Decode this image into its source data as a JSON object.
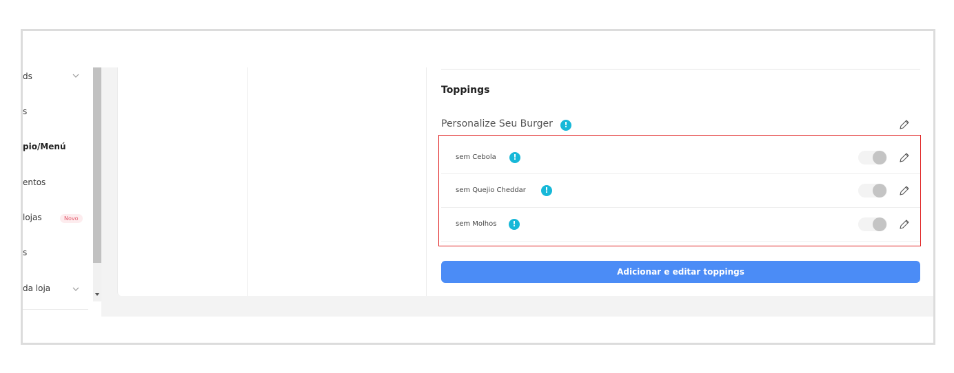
{
  "sidebar": {
    "items": [
      {
        "label": "ds",
        "chevron": true
      },
      {
        "label": "s"
      },
      {
        "label": "pio/Menú",
        "active": true
      },
      {
        "label": "entos"
      },
      {
        "label": "lojas",
        "badge": "Novo"
      },
      {
        "label": "s"
      },
      {
        "label": "da loja",
        "chevron": true
      }
    ]
  },
  "toppings": {
    "section_title": "Toppings",
    "group_title": "Personalize Seu Burger",
    "info_glyph": "!",
    "items": [
      {
        "label": "sem Cebola",
        "enabled": false
      },
      {
        "label": "sem Quejio Cheddar",
        "enabled": false
      },
      {
        "label": "sem Molhos",
        "enabled": false
      }
    ],
    "add_button_label": "Adicionar e editar toppings"
  },
  "colors": {
    "accent": "#4b8cf6",
    "info": "#17b8d8",
    "highlight": "#e02020",
    "badge": "#e3596b"
  },
  "icons": {
    "edit": "pencil-icon",
    "info": "info-icon",
    "chevron": "chevron-down-icon"
  }
}
